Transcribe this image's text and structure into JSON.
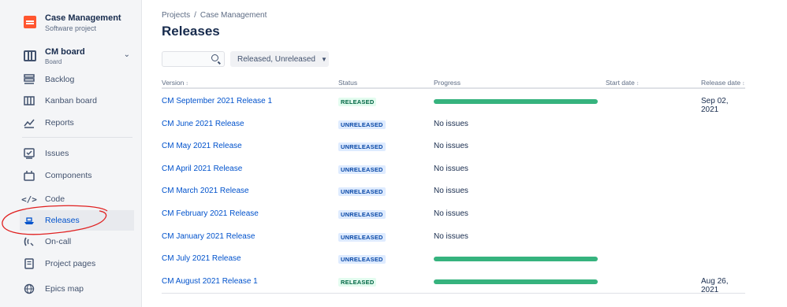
{
  "sidebar": {
    "project": {
      "name": "Case Management",
      "type": "Software project",
      "logo_color": "#ff5630"
    },
    "board": {
      "name": "CM board",
      "sub": "Board"
    },
    "items": [
      {
        "label": "Backlog",
        "icon": "backlog-icon"
      },
      {
        "label": "Kanban board",
        "icon": "kanban-icon"
      },
      {
        "label": "Reports",
        "icon": "reports-icon"
      },
      {
        "label": "Issues",
        "icon": "issues-icon"
      },
      {
        "label": "Components",
        "icon": "components-icon"
      },
      {
        "label": "Code",
        "icon": "code-icon"
      },
      {
        "label": "Releases",
        "icon": "releases-icon",
        "active": true
      },
      {
        "label": "On-call",
        "icon": "on-call-icon"
      },
      {
        "label": "Project pages",
        "icon": "pages-icon"
      },
      {
        "label": "Epics map",
        "icon": "epics-map-icon"
      }
    ]
  },
  "breadcrumb": {
    "root": "Projects",
    "separator": "/",
    "current": "Case Management"
  },
  "page": {
    "title": "Releases"
  },
  "toolbar": {
    "search_value": "",
    "filter_label": "Released, Unreleased"
  },
  "table": {
    "headers": {
      "version": "Version",
      "status": "Status",
      "progress": "Progress",
      "start_date": "Start date",
      "release_date": "Release date"
    },
    "rows": [
      {
        "version": "CM September 2021 Release 1",
        "status": "RELEASED",
        "progress": "",
        "release_date": "Sep 02, 2021"
      },
      {
        "version": "CM June 2021 Release",
        "status": "UNRELEASED",
        "progress": "No issues",
        "release_date": ""
      },
      {
        "version": "CM May 2021 Release",
        "status": "UNRELEASED",
        "progress": "No issues",
        "release_date": ""
      },
      {
        "version": "CM April 2021 Release",
        "status": "UNRELEASED",
        "progress": "No issues",
        "release_date": ""
      },
      {
        "version": "CM March 2021 Release",
        "status": "UNRELEASED",
        "progress": "No issues",
        "release_date": ""
      },
      {
        "version": "CM February 2021 Release",
        "status": "UNRELEASED",
        "progress": "No issues",
        "release_date": ""
      },
      {
        "version": "CM January 2021 Release",
        "status": "UNRELEASED",
        "progress": "No issues",
        "release_date": ""
      },
      {
        "version": "CM July 2021 Release",
        "status": "UNRELEASED",
        "progress": "",
        "release_date": ""
      },
      {
        "version": "CM August 2021 Release 1",
        "status": "RELEASED",
        "progress": "",
        "release_date": "Aug 26, 2021"
      }
    ]
  },
  "colors": {
    "accent": "#0052cc",
    "progress_complete": "#36b37e",
    "annotation": "#e02020"
  }
}
